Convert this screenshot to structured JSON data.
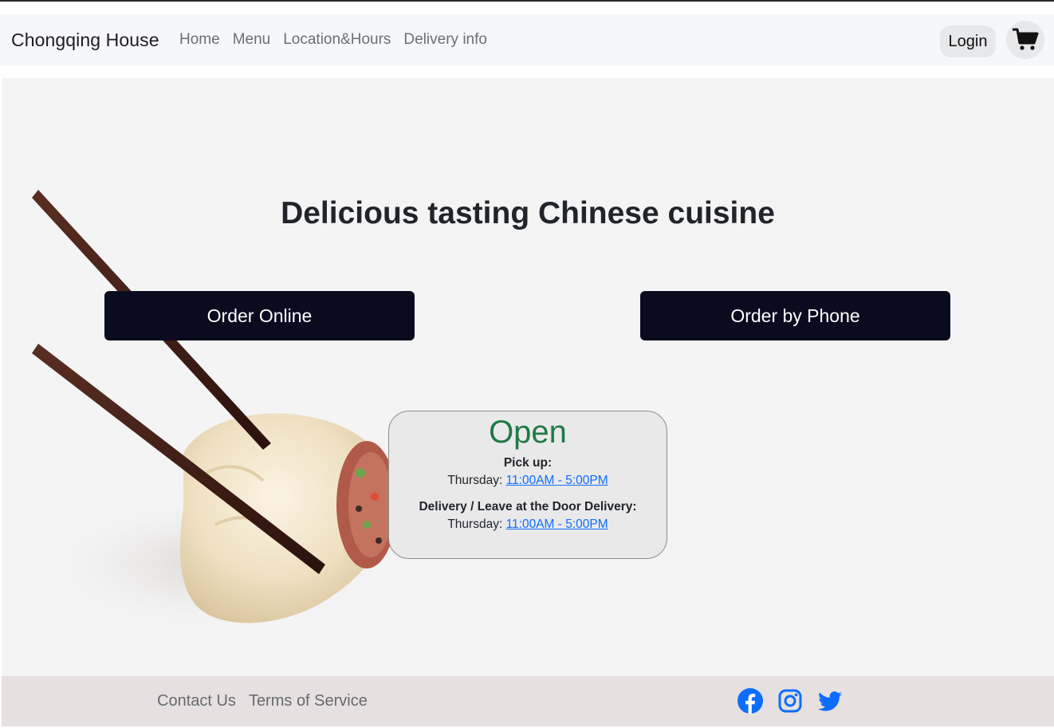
{
  "navbar": {
    "brand": "Chongqing House",
    "links": [
      "Home",
      "Menu",
      "Location&Hours",
      "Delivery info"
    ],
    "login_label": "Login",
    "cart_icon": "cart-icon"
  },
  "hero": {
    "title": "Delicious tasting Chinese cuisine",
    "order_online_label": "Order Online",
    "order_phone_label": "Order by Phone",
    "image": "chopsticks-holding-dumpling"
  },
  "hours": {
    "status": "Open",
    "pickup": {
      "heading": "Pick up:",
      "day": "Thursday:",
      "time": "11:00AM - 5:00PM"
    },
    "delivery": {
      "heading": "Delivery / Leave at the Door Delivery:",
      "day": "Thursday:",
      "time": "11:00AM - 5:00PM"
    }
  },
  "footer": {
    "links": [
      "Contact Us",
      "Terms of Service"
    ],
    "socials": [
      "facebook-icon",
      "instagram-icon",
      "twitter-icon"
    ]
  },
  "colors": {
    "primary_button": "#0b0b20",
    "open_status": "#1f7a45",
    "link": "#0d6efd",
    "social_icons": "#0d6efd",
    "footer_bg": "#e6e0e0",
    "navbar_bg": "#f6f7f9"
  }
}
